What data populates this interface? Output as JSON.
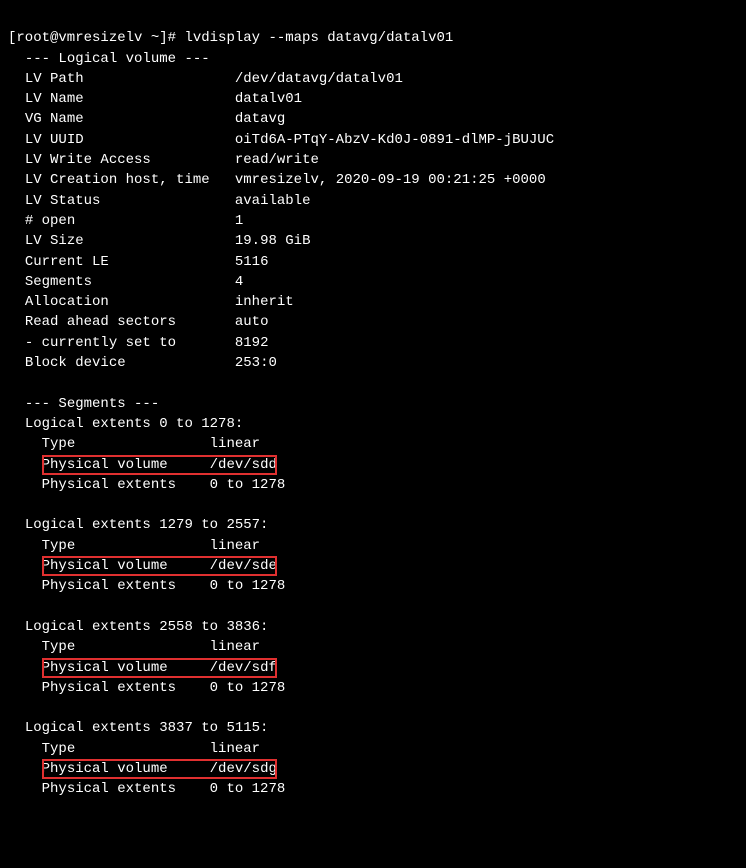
{
  "prompt": "[root@vmresizelv ~]#",
  "command": "lvdisplay --maps datavg/datalv01",
  "lv": {
    "header": "--- Logical volume ---",
    "path": {
      "label": "LV Path",
      "value": "/dev/datavg/datalv01"
    },
    "name": {
      "label": "LV Name",
      "value": "datalv01"
    },
    "vg": {
      "label": "VG Name",
      "value": "datavg"
    },
    "uuid": {
      "label": "LV UUID",
      "value": "oiTd6A-PTqY-AbzV-Kd0J-0891-dlMP-jBUJUC"
    },
    "write": {
      "label": "LV Write Access",
      "value": "read/write"
    },
    "ctime": {
      "label": "LV Creation host, time",
      "value": "vmresizelv, 2020-09-19 00:21:25 +0000"
    },
    "status": {
      "label": "LV Status",
      "value": "available"
    },
    "open": {
      "label": "# open",
      "value": "1"
    },
    "size": {
      "label": "LV Size",
      "value": "19.98 GiB"
    },
    "le": {
      "label": "Current LE",
      "value": "5116"
    },
    "segs": {
      "label": "Segments",
      "value": "4"
    },
    "alloc": {
      "label": "Allocation",
      "value": "inherit"
    },
    "ra": {
      "label": "Read ahead sectors",
      "value": "auto"
    },
    "curset": {
      "label": "- currently set to",
      "value": "8192"
    },
    "block": {
      "label": "Block device",
      "value": "253:0"
    }
  },
  "seg": {
    "header": "--- Segments ---",
    "labels": {
      "type": "Type",
      "pv": "Physical volume",
      "pe": "Physical extents"
    },
    "list": [
      {
        "title": "Logical extents 0 to 1278:",
        "type": "linear",
        "pv": "/dev/sdd",
        "pe": "0 to 1278"
      },
      {
        "title": "Logical extents 1279 to 2557:",
        "type": "linear",
        "pv": "/dev/sde",
        "pe": "0 to 1278"
      },
      {
        "title": "Logical extents 2558 to 3836:",
        "type": "linear",
        "pv": "/dev/sdf",
        "pe": "0 to 1278"
      },
      {
        "title": "Logical extents 3837 to 5115:",
        "type": "linear",
        "pv": "/dev/sdg",
        "pe": "0 to 1278"
      }
    ]
  }
}
